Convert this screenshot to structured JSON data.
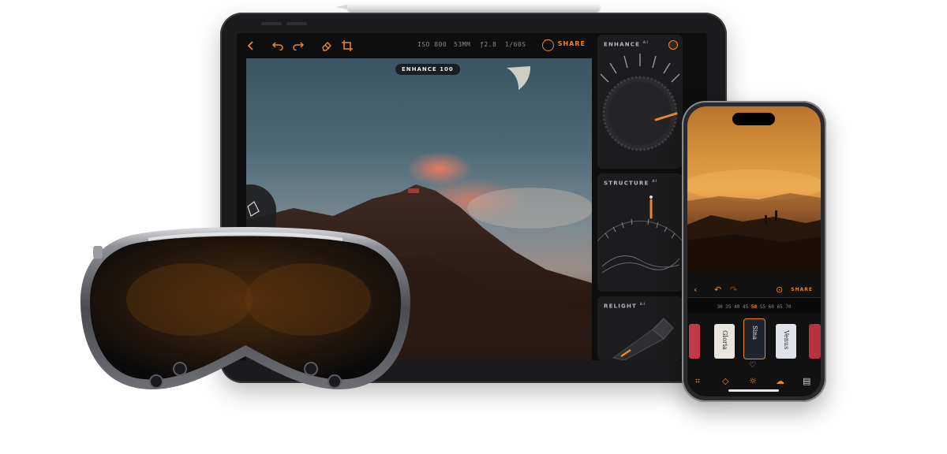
{
  "colors": {
    "accent": "#f0842a",
    "panel_bg": "#1c1c1e",
    "screen_bg": "#0e0e0f"
  },
  "ipad": {
    "toolbar": {
      "back_icon": "chevron-left-icon",
      "undo_icon": "undo-icon",
      "redo_icon": "redo-icon",
      "eraser_icon": "eraser-icon",
      "crop_icon": "crop-icon",
      "iso": "ISO 800",
      "focal": "53MM",
      "aperture": "ƒ2.8",
      "shutter": "1/60S",
      "more_icon": "more-icon",
      "share_label": "SHARE"
    },
    "photo": {
      "enhance_badge": "ENHANCE 100"
    },
    "panels": [
      {
        "title": "ENHANCE",
        "badge": "AI"
      },
      {
        "title": "STRUCTURE",
        "badge": "AI"
      },
      {
        "title": "RELIGHT",
        "badge": "AI"
      }
    ]
  },
  "iphone": {
    "toolbar": {
      "share_label": "SHARE"
    },
    "dial": {
      "before": [
        "30",
        "35",
        "40",
        "45"
      ],
      "selected": "50",
      "after": [
        "55",
        "60",
        "65",
        "70"
      ]
    },
    "films": [
      {
        "name": ""
      },
      {
        "name": "Gloria"
      },
      {
        "name": "Sina"
      },
      {
        "name": "Venus"
      },
      {
        "name": ""
      }
    ],
    "tabs": [
      "crop-icon",
      "eraser-icon",
      "light-icon",
      "weather-icon",
      "film-icon"
    ]
  }
}
